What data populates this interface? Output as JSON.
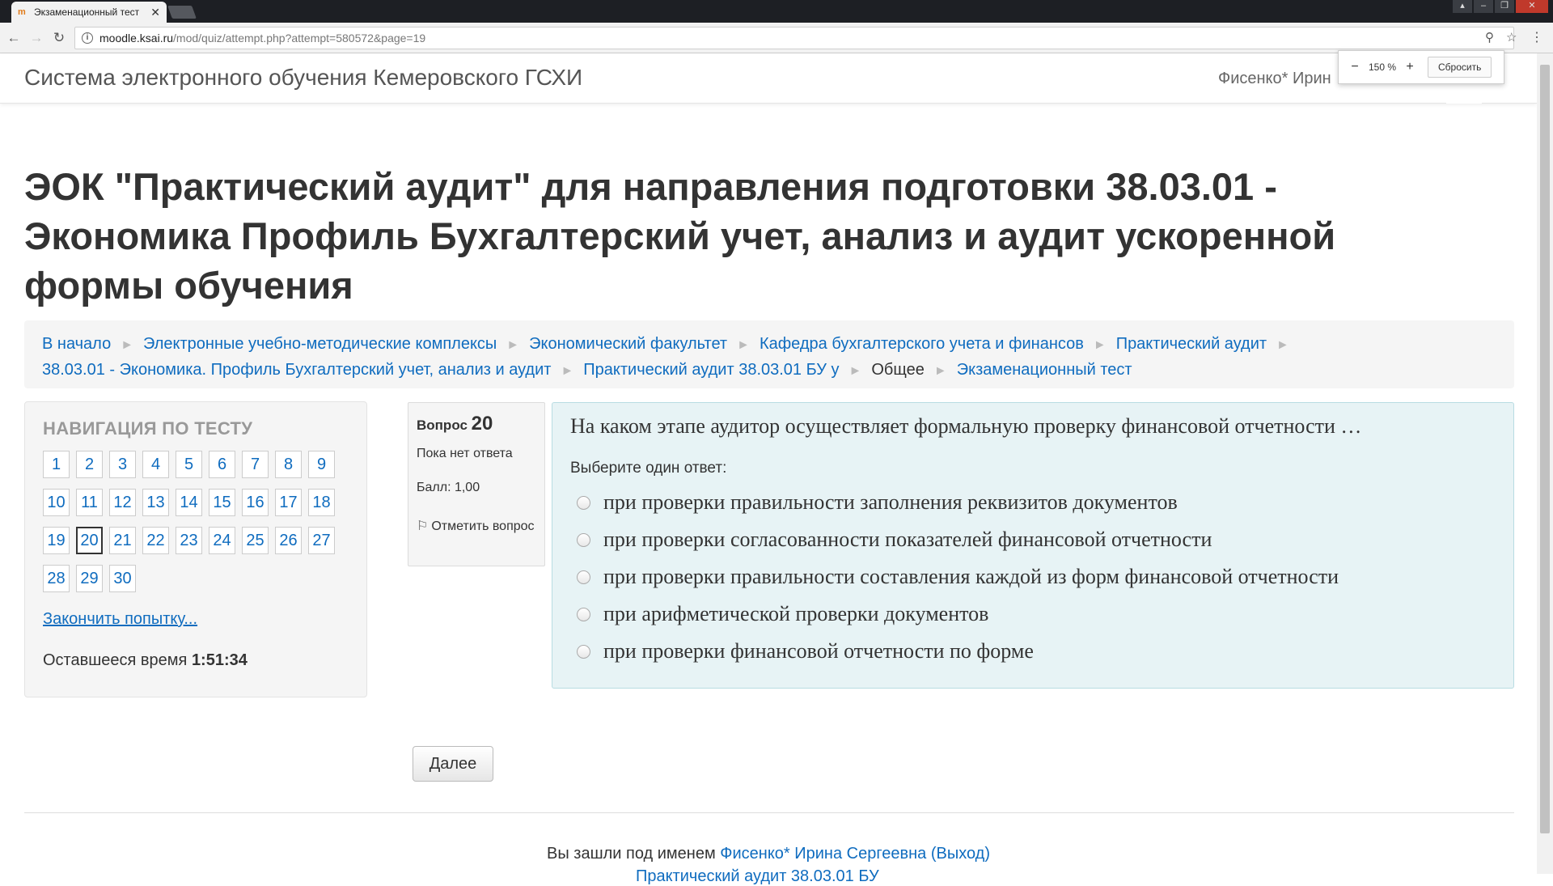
{
  "browser": {
    "tab_title": "Экзаменационный тест",
    "tab_close": "✕",
    "url_host": "moodle.ksai.ru",
    "url_path": "/mod/quiz/attempt.php?attempt=580572&page=19",
    "zoom": {
      "minus": "−",
      "value": "150 %",
      "plus": "+",
      "reset": "Сбросить"
    }
  },
  "header": {
    "site_name": "Система электронного обучения Кемеровского ГСХИ",
    "user_name": "Фисенко* Ирин"
  },
  "page": {
    "title": "ЭОК \"Практический аудит\" для направления подготовки 38.03.01 - Экономика Профиль Бухгалтерский учет, анализ и аудит ускоренной формы обучения"
  },
  "breadcrumb": {
    "items": [
      "В начало",
      "Электронные учебно-методические комплексы",
      "Экономический факультет",
      "Кафедра бухгалтерского учета и финансов",
      "Практический аудит",
      "38.03.01 - Экономика. Профиль Бухгалтерский учет, анализ и аудит",
      "Практический аудит 38.03.01 БУ у",
      "Общее",
      "Экзаменационный тест"
    ],
    "separator": "►"
  },
  "quiz_nav": {
    "heading": "НАВИГАЦИЯ ПО ТЕСТУ",
    "questions": [
      "1",
      "2",
      "3",
      "4",
      "5",
      "6",
      "7",
      "8",
      "9",
      "10",
      "11",
      "12",
      "13",
      "14",
      "15",
      "16",
      "17",
      "18",
      "19",
      "20",
      "21",
      "22",
      "23",
      "24",
      "25",
      "26",
      "27",
      "28",
      "29",
      "30"
    ],
    "current": "20",
    "finish_link": "Закончить попытку...",
    "time_label": "Оставшееся время",
    "time_value": "1:51:34"
  },
  "question_info": {
    "label": "Вопрос",
    "number": "20",
    "state": "Пока нет ответа",
    "grade": "Балл: 1,00",
    "flag_label": "Отметить вопрос"
  },
  "question": {
    "text": "На каком этапе аудитор осуществляет формальную проверку финансовой отчетности …",
    "prompt": "Выберите один ответ:",
    "answers": [
      "при проверки правильности заполнения реквизитов документов",
      "при проверки согласованности показателей финансовой отчетности",
      "при проверки правильности составления каждой из форм финансовой отчетности",
      "при арифметической проверки документов",
      "при проверки финансовой отчетности по форме"
    ]
  },
  "next_button": "Далее",
  "footer": {
    "logged_in_prefix": "Вы зашли под именем",
    "user_full": "Фисенко* Ирина Сергеевна",
    "logout": "(Выход)",
    "course_short": "Практический аудит 38.03.01 БУ"
  }
}
